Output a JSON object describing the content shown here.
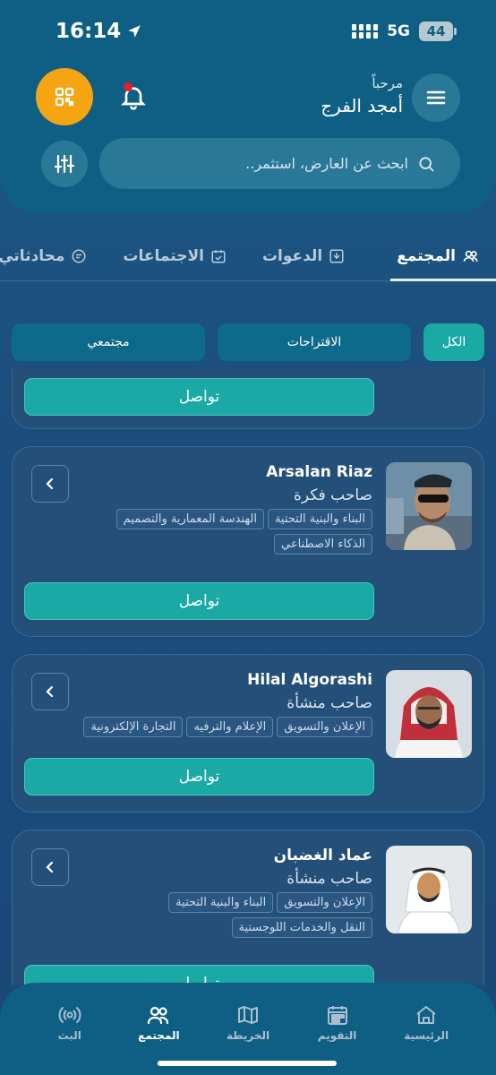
{
  "status": {
    "time": "16:14",
    "network": "5G",
    "battery": "44"
  },
  "header": {
    "greeting": "مرحباً",
    "user_name": "أمجد الفرج",
    "search_placeholder": "ابحث عن العارض، استثمر.."
  },
  "tabs": [
    {
      "label": "المجتمع",
      "active": true
    },
    {
      "label": "الدعوات",
      "active": false
    },
    {
      "label": "الاجتماعات",
      "active": false
    },
    {
      "label": "محادثاتي",
      "active": false
    }
  ],
  "filters": [
    {
      "label": "الكل",
      "active": true
    },
    {
      "label": "الاقتراحات",
      "active": false
    },
    {
      "label": "مجتمعي",
      "active": false
    }
  ],
  "connect_label": "تواصل",
  "people": [
    {
      "name": "Arsalan Riaz",
      "role": "صاحب فكرة",
      "tags": [
        "البناء والبنية التحتية",
        "الهندسة المعمارية والتصميم",
        "الذكاء الاصطناعي"
      ]
    },
    {
      "name": "Hilal Algorashi",
      "role": "صاحب منشأة",
      "tags": [
        "الإعلان والتسويق",
        "الإعلام والترفيه",
        "التجارة الإلكترونية"
      ]
    },
    {
      "name": "عماد الغضبان",
      "role": "صاحب منشأة",
      "tags": [
        "الإعلان والتسويق",
        "البناء والبنية التحتية",
        "النقل والخدمات اللوجستية"
      ]
    }
  ],
  "bottom_nav": [
    {
      "label": "الرئيسية",
      "icon": "home-icon",
      "active": false
    },
    {
      "label": "التقويم",
      "icon": "calendar-icon",
      "active": false
    },
    {
      "label": "الخريطة",
      "icon": "map-icon",
      "active": false
    },
    {
      "label": "المجتمع",
      "icon": "community-icon",
      "active": true
    },
    {
      "label": "البث",
      "icon": "broadcast-icon",
      "active": false
    }
  ],
  "colors": {
    "accent": "#1aa9a5",
    "qr_button": "#f5a412",
    "header": "#0f5f85"
  }
}
